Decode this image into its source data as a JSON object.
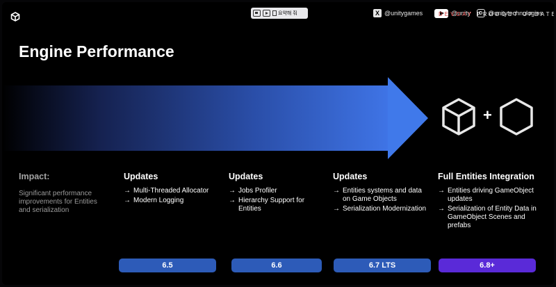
{
  "overlay_toolbar": {
    "summary_label": "요약해 줘"
  },
  "social": {
    "x_handle": "@unitygames",
    "youtube_handle": "@unity",
    "instagram_handle": "@unitytechnologies",
    "event_red": "DEVDAY",
    "event_rest": "PRODUCT UPDATE"
  },
  "slide": {
    "title": "Engine Performance",
    "impact_label": "Impact:",
    "impact_description": "Significant performance improvements for Entities and serialization",
    "columns": [
      {
        "title": "Updates",
        "items": [
          "Multi-Threaded Allocator",
          "Modern Logging"
        ],
        "version": "6.5"
      },
      {
        "title": "Updates",
        "items": [
          "Jobs Profiler",
          "Hierarchy Support for Entities"
        ],
        "version": "6.6"
      },
      {
        "title": "Updates",
        "items": [
          "Entities systems and data on Game Objects",
          "Serialization Modernization"
        ],
        "version": "6.7 LTS"
      },
      {
        "title": "Full Entities Integration",
        "items": [
          "Entities driving GameObject updates",
          "Serialization of Entity Data in GameObject Scenes and prefabs"
        ],
        "version": "6.8+"
      }
    ],
    "plus_sign": "+",
    "arrow_glyph": "→"
  },
  "colors": {
    "background": "#000000",
    "arrow_blue": "#4079ea",
    "pill_blue": "#2d5bb8",
    "pill_purple": "#5a2ad8"
  },
  "icons": [
    "unity-logo-icon",
    "image-icon",
    "play-icon",
    "summary-doc-icon",
    "x-logo-icon",
    "youtube-icon",
    "instagram-icon",
    "cube-icon",
    "hexagon-icon",
    "arrow-icon"
  ]
}
